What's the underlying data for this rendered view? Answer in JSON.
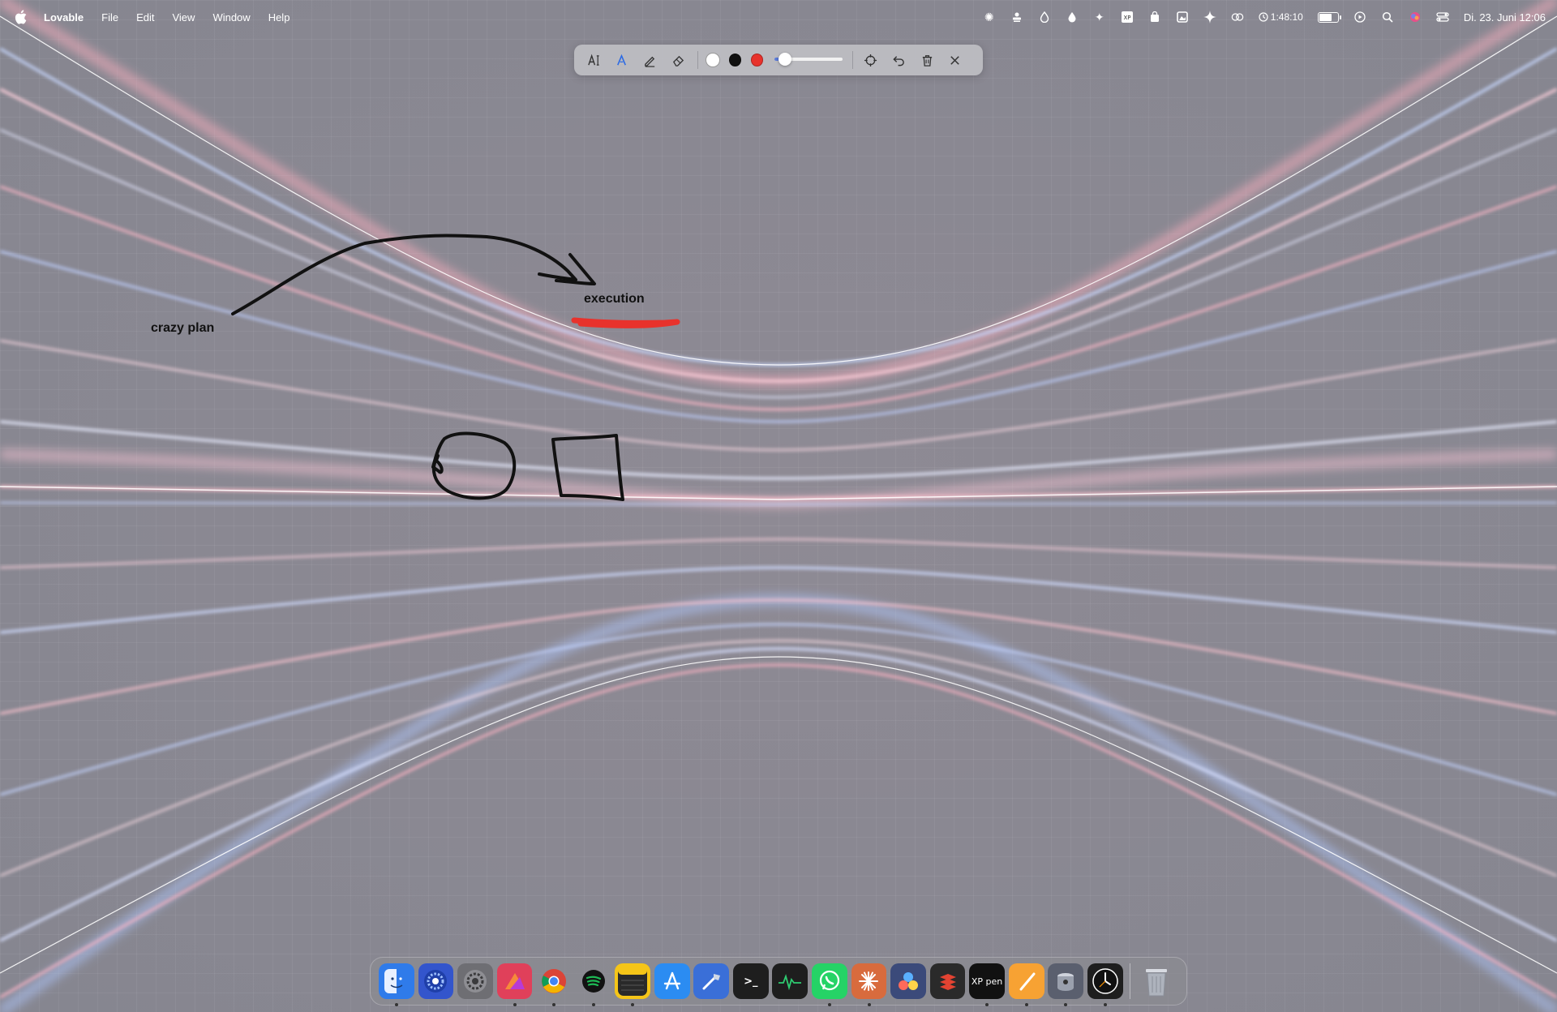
{
  "menubar": {
    "app_name": "Lovable",
    "menus": [
      "File",
      "Edit",
      "View",
      "Window",
      "Help"
    ],
    "timer": "1:48:10",
    "battery_level": 0.75,
    "datetime": "Di. 23. Juni  12:06"
  },
  "toolbar": {
    "tools": [
      "text-tool",
      "pen-tool",
      "highlighter-tool",
      "eraser-tool"
    ],
    "active_tool": "pen-tool",
    "colors": [
      "#ffffff",
      "#111111",
      "#e8322c"
    ],
    "selected_color": "#ffffff",
    "stroke_width": 0.15,
    "actions": [
      "target",
      "undo",
      "delete",
      "close"
    ]
  },
  "canvas": {
    "label_left": "crazy plan",
    "label_right": "execution",
    "ink_color": "#111111",
    "underline_color": "#e8322c"
  },
  "dock": {
    "apps": [
      {
        "name": "finder",
        "color": "#2f7bea",
        "running": true
      },
      {
        "name": "lovable-settings",
        "color": "#3355cc",
        "running": false
      },
      {
        "name": "system-settings",
        "color": "#6e6e73",
        "running": false
      },
      {
        "name": "affinity",
        "color": "#e0405a",
        "running": true
      },
      {
        "name": "chrome",
        "color": "#ffffff",
        "running": true
      },
      {
        "name": "spotify",
        "color": "#1db954",
        "running": true
      },
      {
        "name": "notes",
        "color": "#f5c518",
        "running": true
      },
      {
        "name": "app-store",
        "color": "#2b8cf2",
        "running": false
      },
      {
        "name": "xcode",
        "color": "#3a6fd8",
        "running": false
      },
      {
        "name": "terminal",
        "color": "#1e1e1e",
        "running": false
      },
      {
        "name": "activity-monitor",
        "color": "#1e1e1e",
        "running": false
      },
      {
        "name": "whatsapp",
        "color": "#25d366",
        "running": true
      },
      {
        "name": "claude",
        "color": "#d86b3d",
        "running": true
      },
      {
        "name": "davinci-resolve",
        "color": "#3b4a7a",
        "running": false
      },
      {
        "name": "todoist",
        "color": "#2a2a2a",
        "running": false
      },
      {
        "name": "xp-pen",
        "color": "#111111",
        "label": "XP pen",
        "running": true
      },
      {
        "name": "pages",
        "color": "#f7a233",
        "running": true
      },
      {
        "name": "disk-utility",
        "color": "#5a5f6e",
        "running": true
      },
      {
        "name": "clock",
        "color": "#1e1e1e",
        "running": true
      }
    ],
    "trash": {
      "name": "trash"
    }
  }
}
